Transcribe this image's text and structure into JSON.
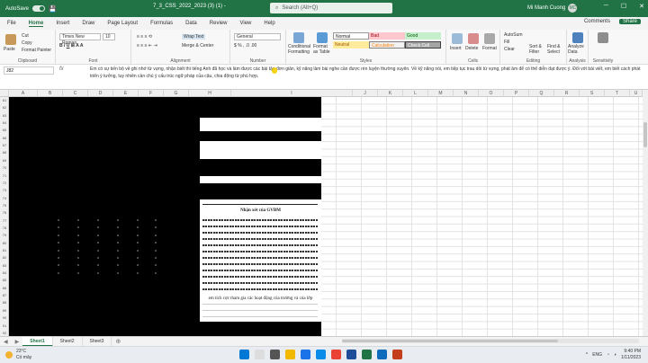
{
  "titlebar": {
    "autosave": "AutoSave",
    "tabs": [
      "Microsoft Excel",
      "Zalo",
      "Google Sheets",
      "Facebook",
      "Office"
    ],
    "window_title": "7_3_CSS_2022_2023 (3) (1) -",
    "search_placeholder": "Search (Alt+Q)",
    "user": "Mi Manh Cuong",
    "initials": "MC"
  },
  "menu": {
    "items": [
      "File",
      "Home",
      "Insert",
      "Draw",
      "Page Layout",
      "Formulas",
      "Data",
      "Review",
      "View",
      "Help"
    ],
    "active": "Home",
    "right": [
      "Comments",
      "Share"
    ]
  },
  "ribbon": {
    "clipboard": {
      "paste": "Paste",
      "cut": "Cut",
      "copy": "Copy",
      "painter": "Format Painter",
      "label": "Clipboard"
    },
    "font": {
      "name": "Times New Roman",
      "size": "10",
      "label": "Font"
    },
    "alignment": {
      "wrap": "Wrap Text",
      "merge": "Merge & Center",
      "label": "Alignment"
    },
    "number": {
      "format": "General",
      "label": "Number"
    },
    "styles": {
      "cond": "Conditional Formatting",
      "table": "Format as Table",
      "normal": "Normal",
      "bad": "Bad",
      "good": "Good",
      "neutral": "Neutral",
      "calc": "Calculation",
      "check": "Check Cell",
      "label": "Styles"
    },
    "cells": {
      "insert": "Insert",
      "delete": "Delete",
      "format": "Format",
      "label": "Cells"
    },
    "editing": {
      "autosum": "AutoSum",
      "fill": "Fill",
      "clear": "Clear",
      "sort": "Sort & Filter",
      "find": "Find & Select",
      "label": "Editing"
    },
    "analysis": {
      "analyze": "Analyze Data",
      "label": "Analysis"
    },
    "sensitivity": {
      "label": "Sensitivity"
    }
  },
  "formula_bar": {
    "name_box": "J82",
    "fx": "fx",
    "content": "Em có sự tiến bộ về ghi nhớ từ vựng, nhận biết thì tiếng Anh đã học và làm được các bài tập đơn giản, kỹ năng làm bài nghe cần được rèn luyện thường xuyên. Về kỹ năng nói, em tiếp tục trau dồi từ vựng, phát âm để có thể diễn đạt được ý. Đối với bài viết, em biết cách phát triển ý tưởng, tuy nhiên cần chú ý cấu trúc ngữ pháp của câu, chia động từ phù hợp."
  },
  "columns": [
    "A",
    "B",
    "C",
    "D",
    "E",
    "F",
    "G",
    "H",
    "I",
    "J",
    "K",
    "L",
    "M",
    "N",
    "O",
    "P",
    "Q",
    "R",
    "S",
    "T",
    "U",
    "V",
    "W"
  ],
  "rows": [
    "61",
    "62",
    "63",
    "64",
    "65",
    "66",
    "67",
    "68",
    "69",
    "70",
    "71",
    "72",
    "73",
    "74",
    "75",
    "76",
    "77",
    "78",
    "79",
    "80",
    "81",
    "82",
    "83",
    "84",
    "85",
    "86",
    "87",
    "88",
    "89",
    "90",
    "91",
    "92"
  ],
  "document": {
    "title": "Nhận xét của GVBM",
    "bottom": "em tích cực tham gia các hoạt động của trường và của lớp"
  },
  "sheets": [
    "Sheet1",
    "Sheet2",
    "Sheet3"
  ],
  "active_sheet": "Sheet1",
  "taskbar": {
    "temp": "23°C",
    "weather": "Có mây",
    "lang": "ENG",
    "time": "9:40 PM",
    "date": "1/11/2023"
  }
}
